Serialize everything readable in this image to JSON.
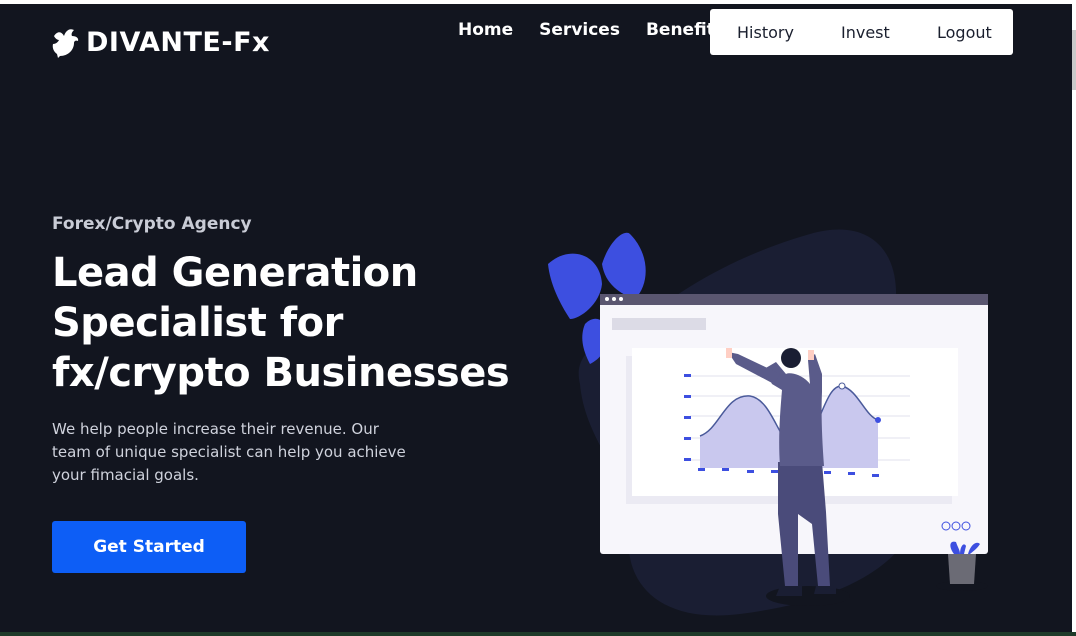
{
  "brand": {
    "name": "DIVANTE-Fx",
    "logo_icon": "dove-icon"
  },
  "nav": {
    "links": [
      "Home",
      "Services",
      "Benefits"
    ],
    "account": [
      "History",
      "Invest",
      "Logout"
    ]
  },
  "hero": {
    "eyebrow": "Forex/Crypto Agency",
    "headline_lines": [
      "Lead Generation",
      "Specialist for",
      "fx/crypto Businesses"
    ],
    "description": "We help people increase their revenue. Our team of unique specialist can help you achieve your fimacial goals.",
    "cta_label": "Get Started"
  },
  "colors": {
    "background": "#12151f",
    "accent": "#0d5ef6",
    "illustration_primary": "#3d4fe0",
    "illustration_dark": "#1a1e33"
  }
}
